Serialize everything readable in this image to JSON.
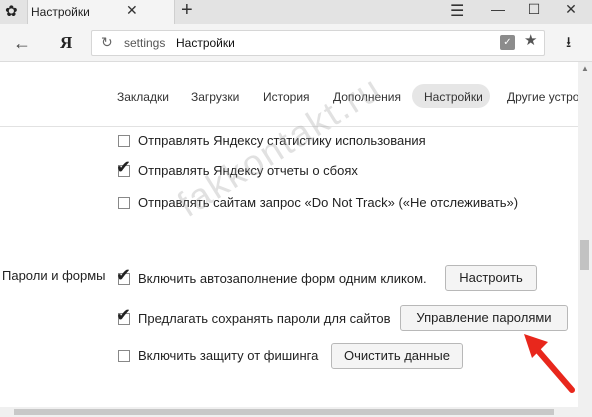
{
  "browser": {
    "tab_title": "Настройки",
    "tab_close": "✕",
    "new_tab": "+",
    "window": {
      "minimize": "—",
      "maximize": "☐",
      "close": "✕"
    },
    "nav_back": "←",
    "logo": "Я",
    "reload": "↻",
    "address_host": "settings",
    "address_title": "Настройки",
    "star": "★",
    "download": "⭳",
    "menu": "☰"
  },
  "settings_nav": {
    "tabs": [
      "Закладки",
      "Загрузки",
      "История",
      "Дополнения",
      "Настройки",
      "Другие устро"
    ],
    "active": "Настройки"
  },
  "content": {
    "options_top": [
      {
        "label": "Отправлять Яндексу статистику использования",
        "checked": false
      },
      {
        "label": "Отправлять Яндексу отчеты о сбоях",
        "checked": true
      },
      {
        "label": "Отправлять сайтам запрос «Do Not Track» («Не отслеживать»)",
        "checked": false
      }
    ],
    "section_passwords": {
      "title": "Пароли и формы",
      "autofill": {
        "label": "Включить автозаполнение форм одним кликом.",
        "checked": true,
        "button": "Настроить"
      },
      "save_passwords": {
        "label": "Предлагать сохранять пароли для сайтов",
        "checked": true,
        "button": "Управление паролями"
      },
      "phishing": {
        "label": "Включить защиту от фишинга",
        "checked": false,
        "button": "Очистить данные"
      }
    }
  },
  "watermark": "fakkontakt.ru",
  "accent_colors": {
    "arrow": "#e8271c",
    "active_tab_bg": "#e6e6e6"
  }
}
